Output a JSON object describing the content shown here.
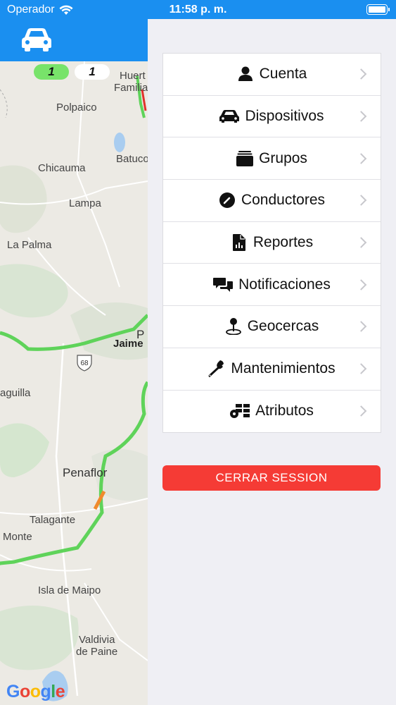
{
  "status_bar": {
    "carrier": "Operador",
    "time": "11:58 p. m."
  },
  "header": {
    "icon": "car-icon"
  },
  "map": {
    "badges": {
      "online": "1",
      "offline": "1"
    },
    "route_shield": "68",
    "labels": {
      "huertos": "Huert",
      "familia": "Familia",
      "polpaico": "Polpaico",
      "chicauma": "Chicauma",
      "batuco": "Batuco",
      "lampa": "Lampa",
      "la_palma": "La Palma",
      "jaime": "Jaime",
      "p": "P",
      "aguilla": "aguilla",
      "penaflor": "Penaflor",
      "talagante": "Talagante",
      "monte": "Monte",
      "isla_de_maipo": "Isla de Maipo",
      "valdivia": "Valdivia",
      "de_paine": "de Paine"
    },
    "attribution": "Google",
    "colors": {
      "traffic_green": "#5fd35a",
      "traffic_orange": "#f08a2d",
      "traffic_red": "#e0322b"
    }
  },
  "menu": {
    "items": [
      {
        "label": "Cuenta",
        "icon": "user-icon"
      },
      {
        "label": "Dispositivos",
        "icon": "car-icon"
      },
      {
        "label": "Grupos",
        "icon": "folder-stack-icon"
      },
      {
        "label": "Conductores",
        "icon": "steering-icon"
      },
      {
        "label": "Reportes",
        "icon": "report-file-icon"
      },
      {
        "label": "Notificaciones",
        "icon": "chat-bubbles-icon"
      },
      {
        "label": "Geocercas",
        "icon": "map-pin-icon"
      },
      {
        "label": "Mantenimientos",
        "icon": "wrench-icon"
      },
      {
        "label": "Atributos",
        "icon": "attributes-icon"
      }
    ]
  },
  "logout_button": "CERRAR SESSION",
  "colors": {
    "accent": "#1a8ff0",
    "danger": "#f53b35",
    "background": "#efeff4"
  }
}
